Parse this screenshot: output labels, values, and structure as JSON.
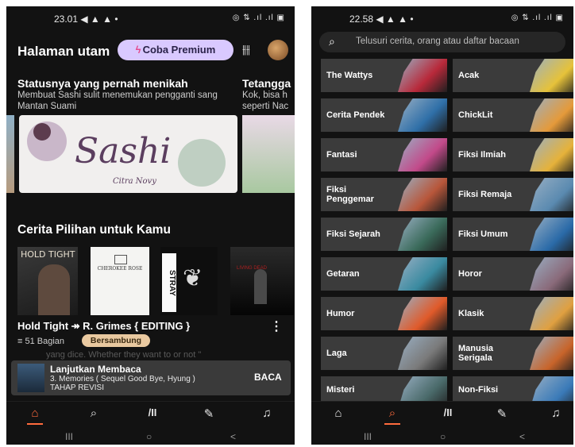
{
  "left": {
    "status": {
      "time": "23.01 ◀ ▲ ▲ •",
      "icons": "◎ ⇅ .ıl .ıl ▣"
    },
    "header": {
      "title": "Halaman utam",
      "premium_label": "Coba Premium"
    },
    "featured": {
      "title": "Statusnya yang pernah menikah",
      "desc": "Membuat Sashi sulit menemukan pengganti sang Mantan Suami",
      "banner_title": "Sashi",
      "banner_author": "Citra Novy",
      "next_title": "Tetangga",
      "next_desc": "Kok, bisa h seperti Nac"
    },
    "section_title": "Cerita Pilihan untuk Kamu",
    "covers": {
      "c1": "HOLD TIGHT",
      "c2": "CHEROKEE ROSE",
      "c3": "STRAY",
      "c4": "LIVING DEAD"
    },
    "book": {
      "title": "Hold Tight ↠ R. Grimes { EDITING }",
      "parts": "≡ 51 Bagian",
      "status": "Bersambung",
      "faded": "yang dice. Whether they want to or not \""
    },
    "continue": {
      "label": "Lanjutkan Membaca",
      "chapter": "3. Memories ( Sequel Good Bye, Hyung )",
      "note": "TAHAP REVISI",
      "action": "BACA"
    },
    "nav": {
      "home": "⌂",
      "search": "⌕",
      "library": "/II",
      "write": "✎",
      "notif": "♫"
    },
    "sysnav": {
      "recent": "III",
      "home": "○",
      "back": "<"
    }
  },
  "right": {
    "status": {
      "time": "22.58 ◀ ▲ ▲ •",
      "icons": "◎ ⇅ .ıl .ıl ▣"
    },
    "search_placeholder": "Telusuri cerita, orang atau daftar bacaan",
    "categories": [
      {
        "label": "The Wattys",
        "color": "#b8293a"
      },
      {
        "label": "Acak",
        "color": "#e6c23a"
      },
      {
        "label": "Cerita Pendek",
        "color": "#2f6fa8"
      },
      {
        "label": "ChickLit",
        "color": "#e59a3a"
      },
      {
        "label": "Fantasi",
        "color": "#c24a8a"
      },
      {
        "label": "Fiksi Ilmiah",
        "color": "#e6b23a"
      },
      {
        "label": "Fiksi Penggemar",
        "color": "#b8563a"
      },
      {
        "label": "Fiksi Remaja",
        "color": "#5a8ab0"
      },
      {
        "label": "Fiksi Sejarah",
        "color": "#3a6a5a"
      },
      {
        "label": "Fiksi Umum",
        "color": "#2a6aa8"
      },
      {
        "label": "Getaran",
        "color": "#3a8aa0"
      },
      {
        "label": "Horor",
        "color": "#8a6a7a"
      },
      {
        "label": "Humor",
        "color": "#e05a2a"
      },
      {
        "label": "Klasik",
        "color": "#e0a040"
      },
      {
        "label": "Laga",
        "color": "#7a7a7a"
      },
      {
        "label": "Manusia Serigala",
        "color": "#c8642a"
      },
      {
        "label": "Misteri",
        "color": "#4a6a6a"
      },
      {
        "label": "Non-Fiksi",
        "color": "#3a7ab8"
      }
    ],
    "nav": {
      "home": "⌂",
      "search": "⌕",
      "library": "/II",
      "write": "✎",
      "notif": "♫"
    },
    "sysnav": {
      "recent": "III",
      "home": "○",
      "back": "<"
    }
  },
  "colors": {
    "accent": "#ff6b3d",
    "premium_bg": "#d9c9ff",
    "badge_bg": "#e9c9a0",
    "bg": "#121212"
  }
}
